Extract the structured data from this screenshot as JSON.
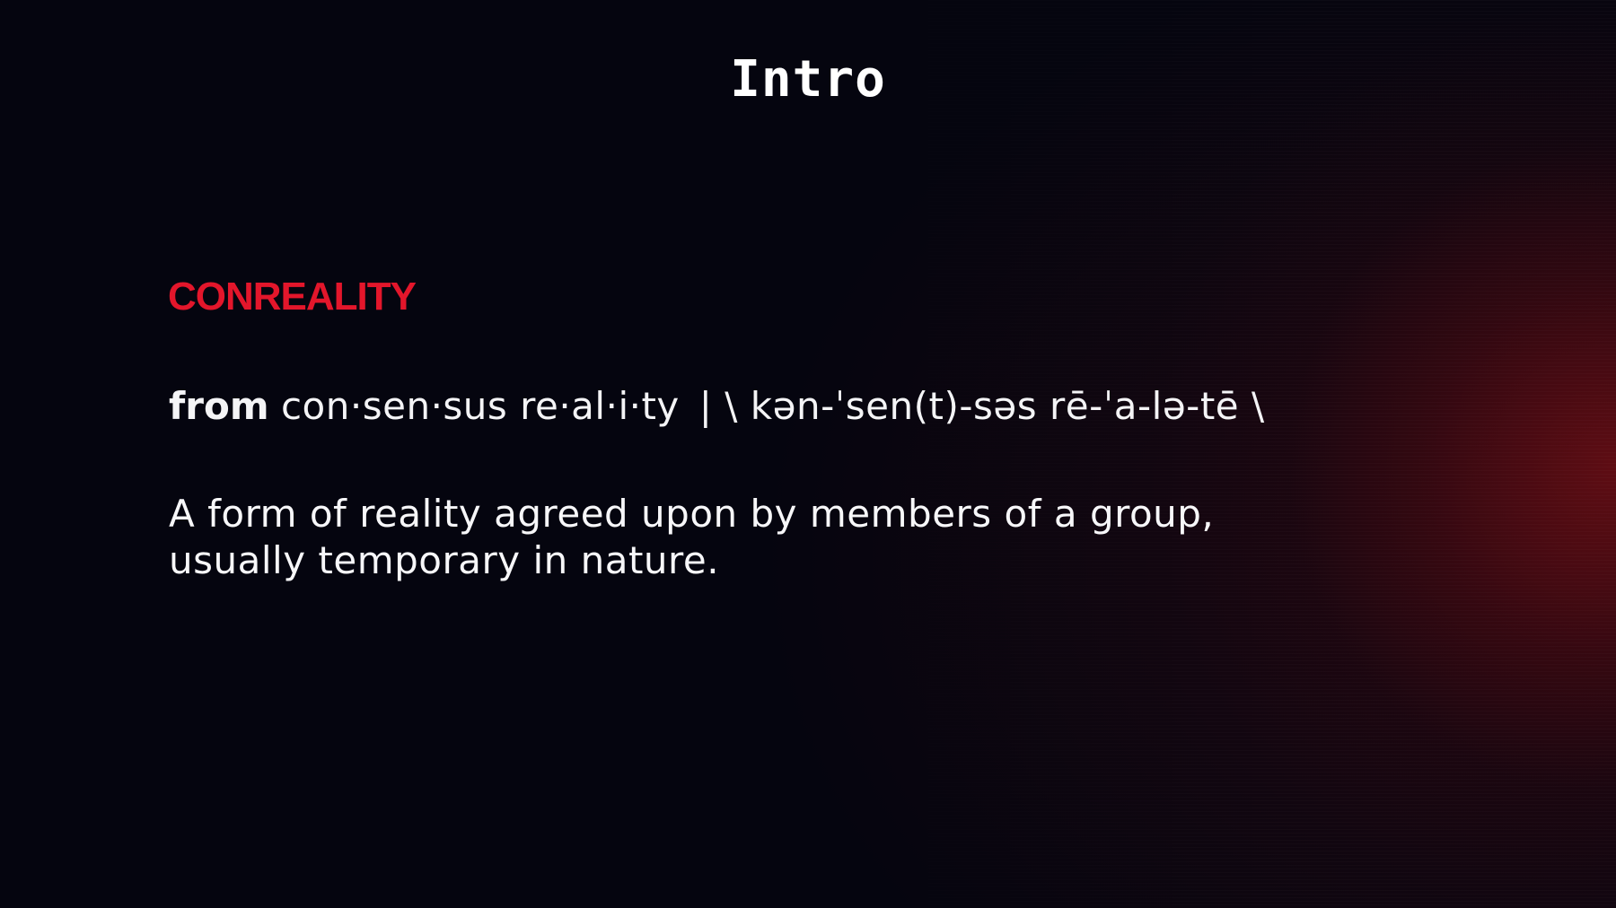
{
  "slide": {
    "title": "Intro",
    "term": "CONREALITY",
    "etymology": {
      "from_word": "from",
      "source": "con·sen·sus re·al·i·ty",
      "pronunciation": "| \\ kən-ˈsen(t)-səs rē-ˈa-lə-tē \\"
    },
    "definition": "A form of reality agreed upon by members of a group, usually temporary in nature."
  },
  "colors": {
    "background": "#05050f",
    "accent_red": "#e3162b",
    "text": "#ffffff"
  }
}
